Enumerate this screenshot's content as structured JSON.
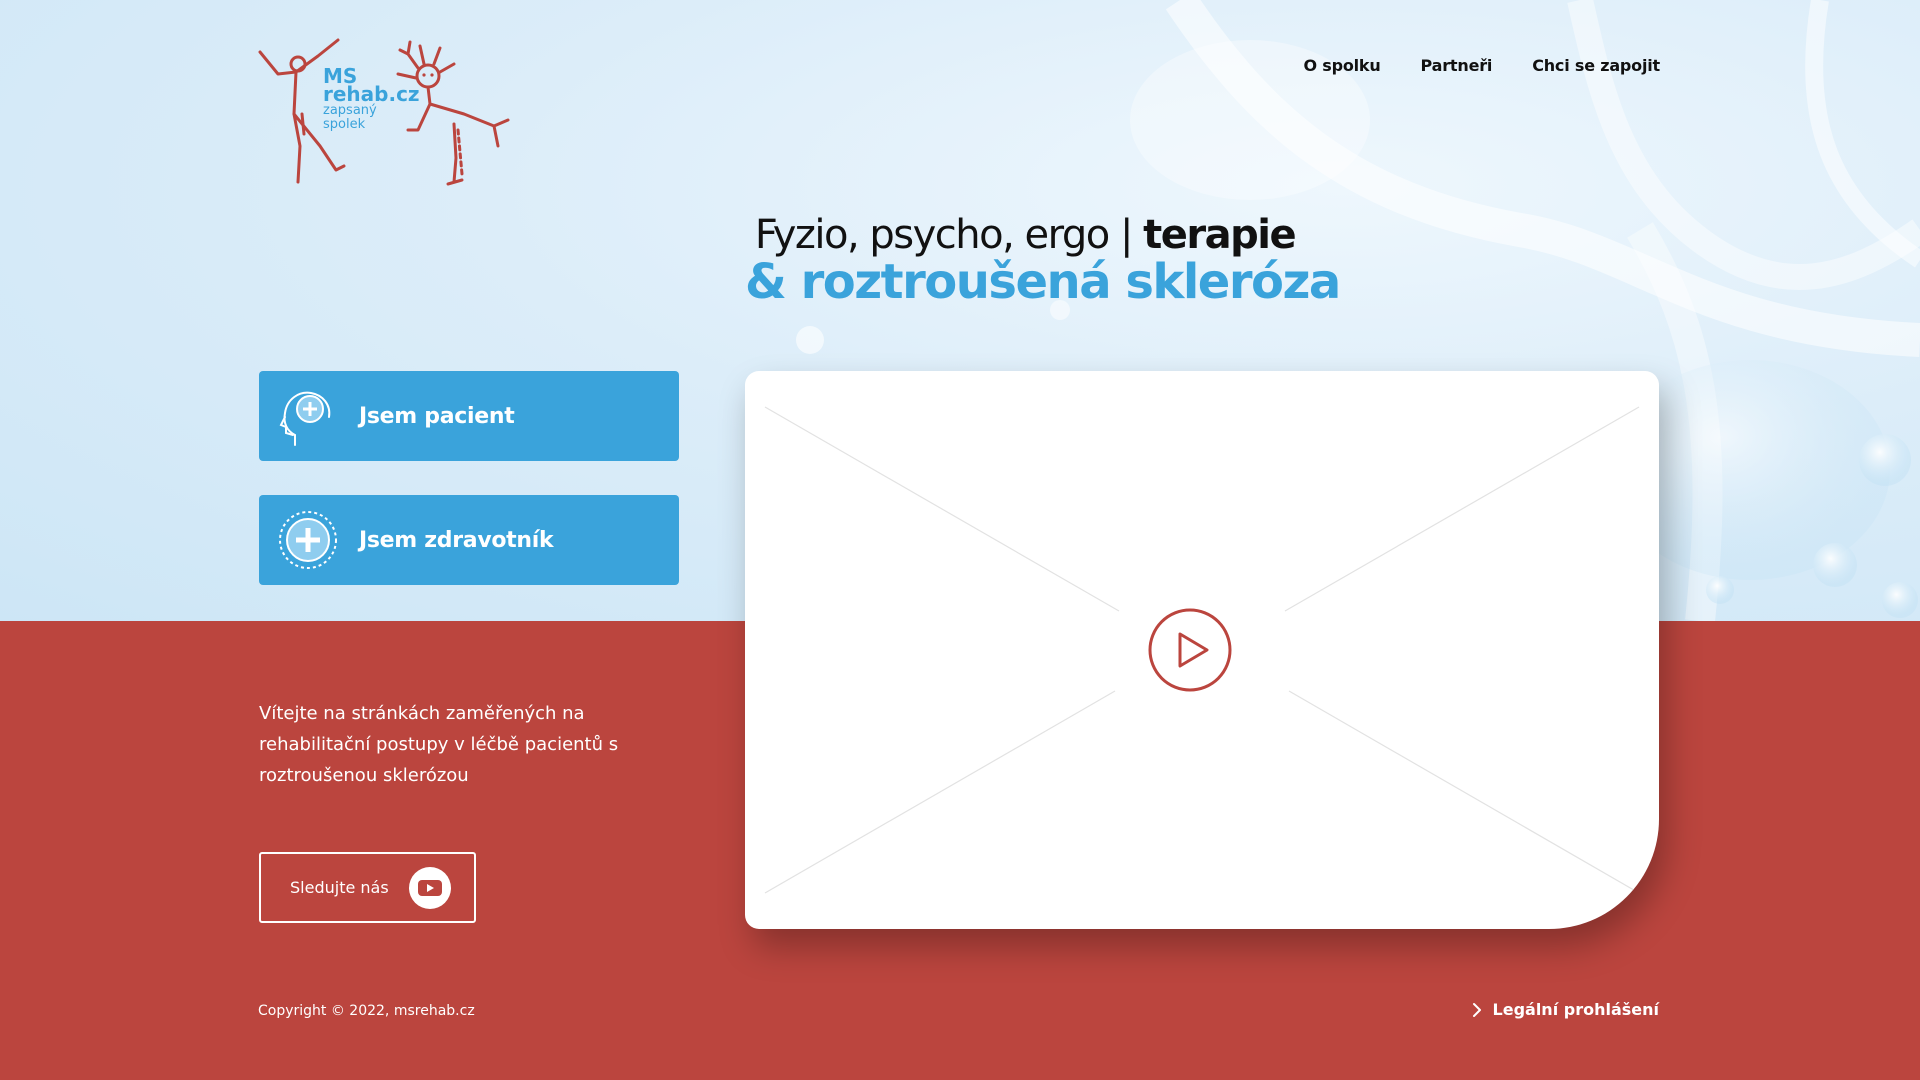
{
  "brand": {
    "logo_ms": "MS",
    "logo_rehab": "rehab.cz",
    "logo_sub1": "zapsaný",
    "logo_sub2": "spolek"
  },
  "nav": {
    "items": [
      {
        "label": "O spolku"
      },
      {
        "label": "Partneři"
      },
      {
        "label": "Chci se zapojit"
      }
    ]
  },
  "headline": {
    "line1_regular": "Fyzio, psycho, ergo | ",
    "line1_bold": "terapie",
    "line2": "& roztroušená skleróza"
  },
  "roles": {
    "patient": "Jsem pacient",
    "professional": "Jsem zdravotník"
  },
  "welcome_text": "Vítejte na stránkách zaměřených na rehabilitační postupy v léčbě pacientů s roztroušenou sklerózou",
  "follow": {
    "label": "Sledujte nás",
    "icon": "youtube-icon"
  },
  "footer": {
    "copyright": "Copyright © 2022, msrehab.cz",
    "legal": "Legální prohlášení"
  },
  "colors": {
    "accent_blue": "#3aa3db",
    "brand_red": "#bb453e",
    "hero_bg": "#dcedf9"
  }
}
